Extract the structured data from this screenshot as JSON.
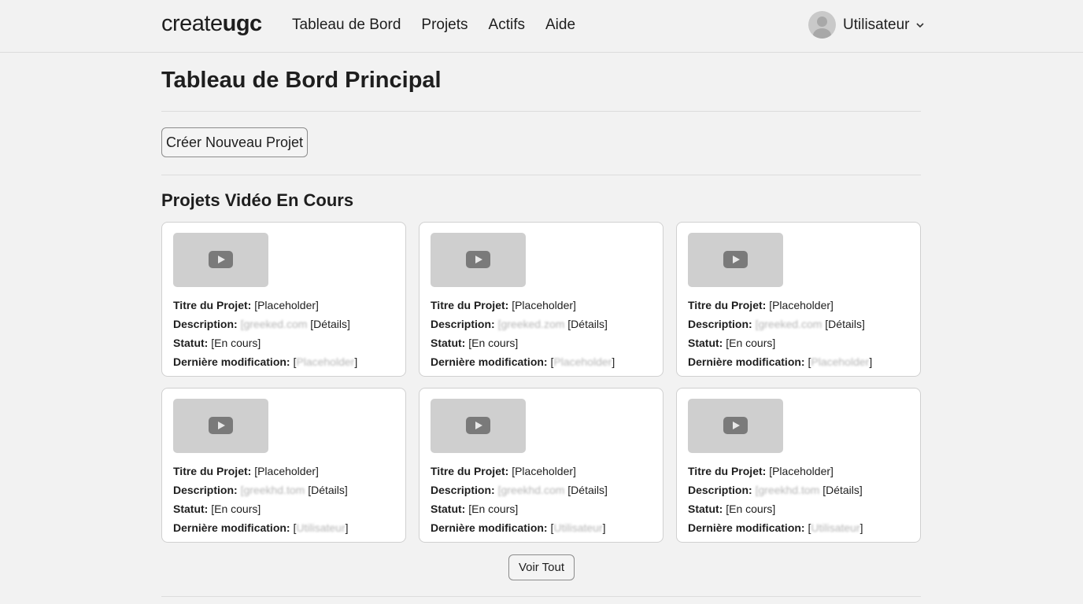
{
  "header": {
    "logo_light": "create",
    "logo_bold": "ugc",
    "nav": [
      "Tableau de Bord",
      "Projets",
      "Actifs",
      "Aide"
    ],
    "user_name": "Utilisateur",
    "avatar_icon": "user-avatar-icon",
    "chevron_icon": "chevron-down-icon"
  },
  "page": {
    "title": "Tableau de Bord Principal",
    "new_project_label": "Créer Nouveau Projet",
    "section_title": "Projets Vidéo En Cours",
    "view_all_label": "Voir Tout"
  },
  "labels": {
    "title": "Titre du Projet:",
    "description": "Description:",
    "status": "Statut:",
    "modified": "Dernière modification:"
  },
  "projects": [
    {
      "title": "[Placeholder]",
      "description_blur": "[greeked.com",
      "details": "[Détails]",
      "status": "[En cours]",
      "modified_open": "[",
      "modified_blur": "Placeholder",
      "modified_close": "]"
    },
    {
      "title": "[Placeholder]",
      "description_blur": "[greeked.zom",
      "details": "[Détails]",
      "status": "[En cours]",
      "modified_open": "[",
      "modified_blur": "Placeholder",
      "modified_close": "]"
    },
    {
      "title": "[Placeholder]",
      "description_blur": "[greeked.com",
      "details": "[Détails]",
      "status": "[En cours]",
      "modified_open": "[",
      "modified_blur": "Placeholder",
      "modified_close": "]"
    },
    {
      "title": "[Placeholder]",
      "description_blur": "[greekhd.tom",
      "details": "[Détails]",
      "status": "[En cours]",
      "modified_open": "[",
      "modified_blur": "Utilisateur",
      "modified_close": "]"
    },
    {
      "title": "[Placeholder]",
      "description_blur": "[greekhd.com",
      "details": "[Détails]",
      "status": "[En cours]",
      "modified_open": "[",
      "modified_blur": "Utilisateur",
      "modified_close": "]"
    },
    {
      "title": "[Placeholder]",
      "description_blur": "[greekhd.tom",
      "details": "[Détails]",
      "status": "[En cours]",
      "modified_open": "[",
      "modified_blur": "Utilisateur",
      "modified_close": "]"
    }
  ],
  "icons": {
    "thumbnail_play": "play-icon"
  },
  "colors": {
    "background": "#f2f2f2",
    "card": "#ffffff",
    "thumbnail": "#cfcfcf"
  }
}
